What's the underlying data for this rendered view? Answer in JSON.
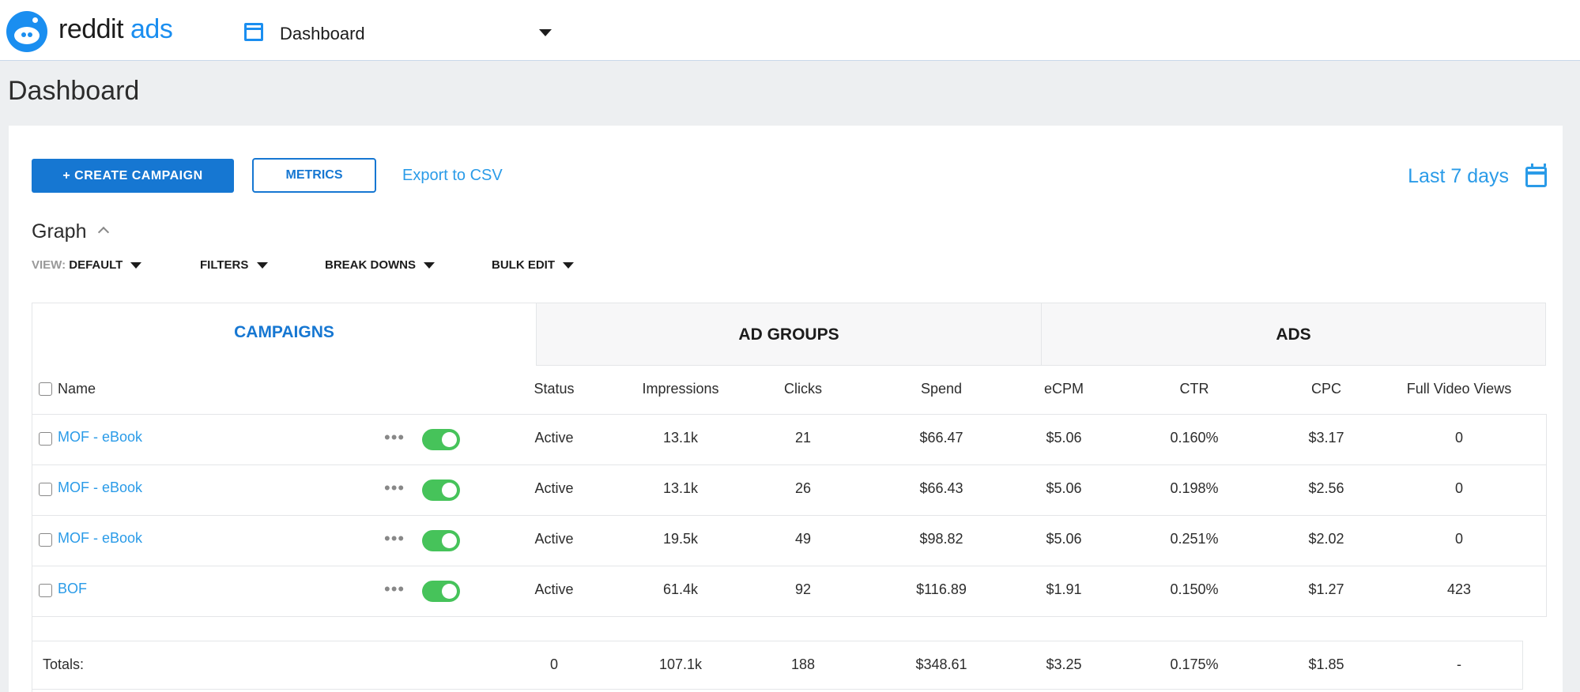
{
  "brand": {
    "reddit": "reddit",
    "ads": "ads",
    "accent": "#1a8ef0"
  },
  "nav": {
    "selector_label": "Dashboard",
    "selector_icon": "window-icon"
  },
  "page": {
    "title": "Dashboard"
  },
  "toolbar": {
    "create_label": "+ CREATE CAMPAIGN",
    "metrics_label": "METRICS",
    "export_label": "Export to CSV",
    "date_range": "Last 7 days",
    "calendar_icon": "calendar-icon"
  },
  "graph": {
    "label": "Graph"
  },
  "filters": {
    "view_prefix": "VIEW:",
    "view_value": "DEFAULT",
    "filters": "FILTERS",
    "breakdowns": "BREAK DOWNS",
    "bulk_edit": "BULK EDIT"
  },
  "tabs": [
    {
      "label": "CAMPAIGNS",
      "active": true
    },
    {
      "label": "AD GROUPS",
      "active": false
    },
    {
      "label": "ADS",
      "active": false
    }
  ],
  "table": {
    "columns": [
      "Name",
      "Status",
      "Impressions",
      "Clicks",
      "Spend",
      "eCPM",
      "CTR",
      "CPC",
      "Full Video Views"
    ],
    "rows": [
      {
        "name": "MOF - eBook",
        "status": "Active",
        "impressions": "13.1k",
        "clicks": "21",
        "spend": "$66.47",
        "ecpm": "$5.06",
        "ctr": "0.160%",
        "cpc": "$3.17",
        "fvv": "0",
        "enabled": true
      },
      {
        "name": "MOF - eBook",
        "status": "Active",
        "impressions": "13.1k",
        "clicks": "26",
        "spend": "$66.43",
        "ecpm": "$5.06",
        "ctr": "0.198%",
        "cpc": "$2.56",
        "fvv": "0",
        "enabled": true
      },
      {
        "name": "MOF - eBook",
        "status": "Active",
        "impressions": "19.5k",
        "clicks": "49",
        "spend": "$98.82",
        "ecpm": "$5.06",
        "ctr": "0.251%",
        "cpc": "$2.02",
        "fvv": "0",
        "enabled": true
      },
      {
        "name": "BOF",
        "status": "Active",
        "impressions": "61.4k",
        "clicks": "92",
        "spend": "$116.89",
        "ecpm": "$1.91",
        "ctr": "0.150%",
        "cpc": "$1.27",
        "fvv": "423",
        "enabled": true
      }
    ],
    "totals": {
      "label": "Totals:",
      "status": "0",
      "impressions": "107.1k",
      "clicks": "188",
      "spend": "$348.61",
      "ecpm": "$3.25",
      "ctr": "0.175%",
      "cpc": "$1.85",
      "fvv": "-"
    }
  },
  "colors": {
    "primary": "#1677d2",
    "link": "#2a9be8",
    "toggle_on": "#46c35a"
  }
}
